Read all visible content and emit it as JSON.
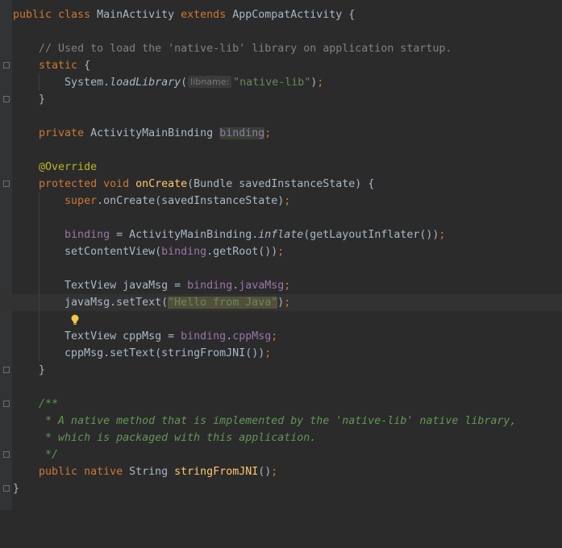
{
  "editor": {
    "language": "java",
    "lines": [
      [
        "public class MainActivity extends AppCompatActivity {"
      ],
      [
        ""
      ],
      [
        "// Used to load the 'native-lib' library on application startup."
      ],
      [
        "static {"
      ],
      [
        "System.",
        "loadLibrary",
        "(",
        "libname:",
        "\"native-lib\"",
        ");"
      ],
      [
        "}"
      ],
      [
        ""
      ],
      [
        "private ",
        "ActivityMainBinding ",
        "binding",
        ";"
      ],
      [
        ""
      ],
      [
        "@Override"
      ],
      [
        "protected ",
        "void ",
        "onCreate",
        "(Bundle savedInstanceState) {"
      ],
      [
        "super",
        ".onCreate(savedInstanceState);"
      ],
      [
        ""
      ],
      [
        "binding",
        " = ActivityMainBinding.",
        "inflate",
        "(getLayoutInflater());"
      ],
      [
        "setContentView(",
        "binding",
        ".getRoot());"
      ],
      [
        ""
      ],
      [
        "TextView javaMsg = ",
        "binding",
        ".",
        "javaMsg",
        ";"
      ],
      [
        "javaMsg.setText(",
        "\"Hello from Java\"",
        ");"
      ],
      [
        ""
      ],
      [
        "TextView cppMsg = ",
        "binding",
        ".",
        "cppMsg",
        ";"
      ],
      [
        "cppMsg.setText(stringFromJNI());"
      ],
      [
        "}"
      ],
      [
        ""
      ],
      [
        "/**"
      ],
      [
        " * A native method that is implemented by the 'native-lib' native library,"
      ],
      [
        " * which is packaged with this application."
      ],
      [
        " */"
      ],
      [
        "public ",
        "native ",
        "String ",
        "stringFromJNI",
        "();"
      ],
      [
        "}"
      ]
    ]
  },
  "colors": {
    "background": "#2b2b2b",
    "keyword": "#cc7832",
    "method_declaration": "#ffc66d",
    "field": "#9876aa",
    "string": "#6a8759",
    "comment": "#808080",
    "javadoc": "#629755",
    "annotation": "#bbb529"
  },
  "icons": {
    "intention_bulb": "lightbulb-icon",
    "fold_marker": "fold-marker-icon"
  },
  "caret_line": 18
}
